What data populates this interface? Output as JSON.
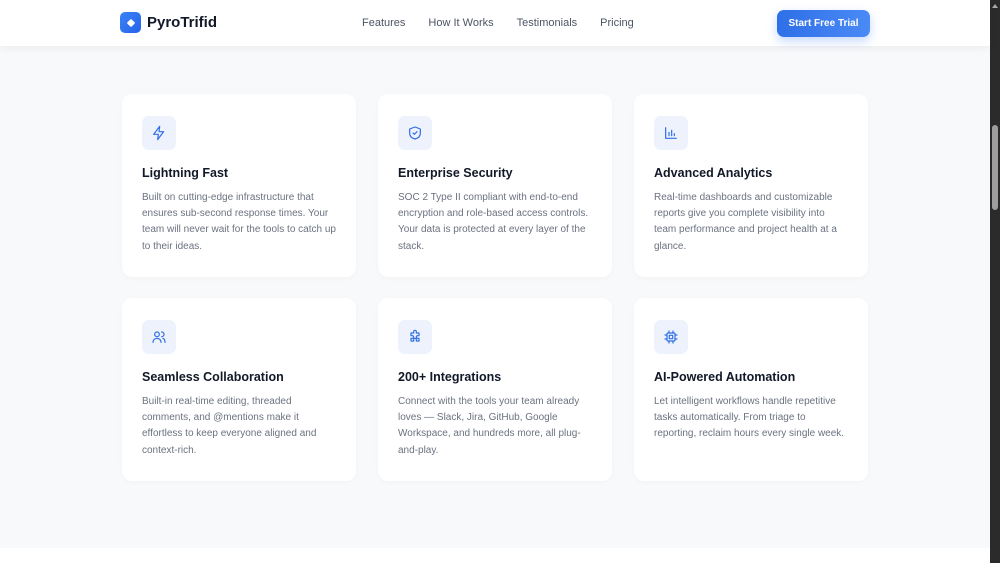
{
  "brand": {
    "name": "PyroTrifid"
  },
  "nav": {
    "links": [
      "Features",
      "How It Works",
      "Testimonials",
      "Pricing"
    ],
    "cta": "Start Free Trial"
  },
  "features": [
    {
      "icon": "lightning-icon",
      "title": "Lightning Fast",
      "desc": "Built on cutting-edge infrastructure that ensures sub-second response times. Your team will never wait for the tools to catch up to their ideas."
    },
    {
      "icon": "shield-icon",
      "title": "Enterprise Security",
      "desc": "SOC 2 Type II compliant with end-to-end encryption and role-based access controls. Your data is protected at every layer of the stack."
    },
    {
      "icon": "bar-chart-icon",
      "title": "Advanced Analytics",
      "desc": "Real-time dashboards and customizable reports give you complete visibility into team performance and project health at a glance."
    },
    {
      "icon": "users-icon",
      "title": "Seamless Collaboration",
      "desc": "Built-in real-time editing, threaded comments, and @mentions make it effortless to keep everyone aligned and context-rich."
    },
    {
      "icon": "puzzle-icon",
      "title": "200+ Integrations",
      "desc": "Connect with the tools your team already loves — Slack, Jira, GitHub, Google Workspace, and hundreds more, all plug-and-play."
    },
    {
      "icon": "cpu-icon",
      "title": "AI-Powered Automation",
      "desc": "Let intelligent workflows handle repetitive tasks automatically. From triage to reporting, reclaim hours every single week."
    }
  ]
}
